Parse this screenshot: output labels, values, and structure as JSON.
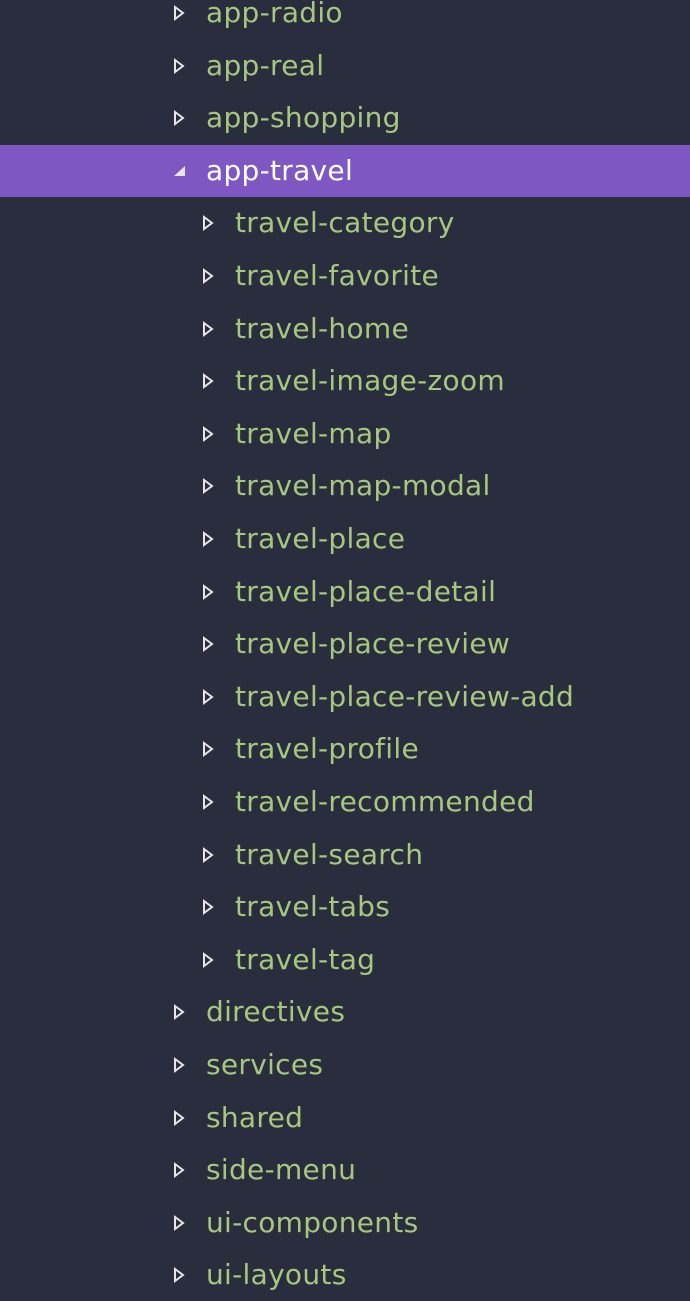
{
  "theme": {
    "background": "#292d3e",
    "label_color": "#a6c77e",
    "selected_background": "#7e57c2",
    "selected_label_color": "#ffffff",
    "twisty_color": "#e6e6e6"
  },
  "tree": {
    "items": [
      {
        "label": "app-radio",
        "level": 0,
        "expanded": false,
        "selected": false
      },
      {
        "label": "app-real",
        "level": 0,
        "expanded": false,
        "selected": false
      },
      {
        "label": "app-shopping",
        "level": 0,
        "expanded": false,
        "selected": false
      },
      {
        "label": "app-travel",
        "level": 0,
        "expanded": true,
        "selected": true
      },
      {
        "label": "travel-category",
        "level": 1,
        "expanded": false,
        "selected": false
      },
      {
        "label": "travel-favorite",
        "level": 1,
        "expanded": false,
        "selected": false
      },
      {
        "label": "travel-home",
        "level": 1,
        "expanded": false,
        "selected": false
      },
      {
        "label": "travel-image-zoom",
        "level": 1,
        "expanded": false,
        "selected": false
      },
      {
        "label": "travel-map",
        "level": 1,
        "expanded": false,
        "selected": false
      },
      {
        "label": "travel-map-modal",
        "level": 1,
        "expanded": false,
        "selected": false
      },
      {
        "label": "travel-place",
        "level": 1,
        "expanded": false,
        "selected": false
      },
      {
        "label": "travel-place-detail",
        "level": 1,
        "expanded": false,
        "selected": false
      },
      {
        "label": "travel-place-review",
        "level": 1,
        "expanded": false,
        "selected": false
      },
      {
        "label": "travel-place-review-add",
        "level": 1,
        "expanded": false,
        "selected": false
      },
      {
        "label": "travel-profile",
        "level": 1,
        "expanded": false,
        "selected": false
      },
      {
        "label": "travel-recommended",
        "level": 1,
        "expanded": false,
        "selected": false
      },
      {
        "label": "travel-search",
        "level": 1,
        "expanded": false,
        "selected": false
      },
      {
        "label": "travel-tabs",
        "level": 1,
        "expanded": false,
        "selected": false
      },
      {
        "label": "travel-tag",
        "level": 1,
        "expanded": false,
        "selected": false
      },
      {
        "label": "directives",
        "level": 0,
        "expanded": false,
        "selected": false
      },
      {
        "label": "services",
        "level": 0,
        "expanded": false,
        "selected": false
      },
      {
        "label": "shared",
        "level": 0,
        "expanded": false,
        "selected": false
      },
      {
        "label": "side-menu",
        "level": 0,
        "expanded": false,
        "selected": false
      },
      {
        "label": "ui-components",
        "level": 0,
        "expanded": false,
        "selected": false
      },
      {
        "label": "ui-layouts",
        "level": 0,
        "expanded": false,
        "selected": false
      }
    ]
  }
}
